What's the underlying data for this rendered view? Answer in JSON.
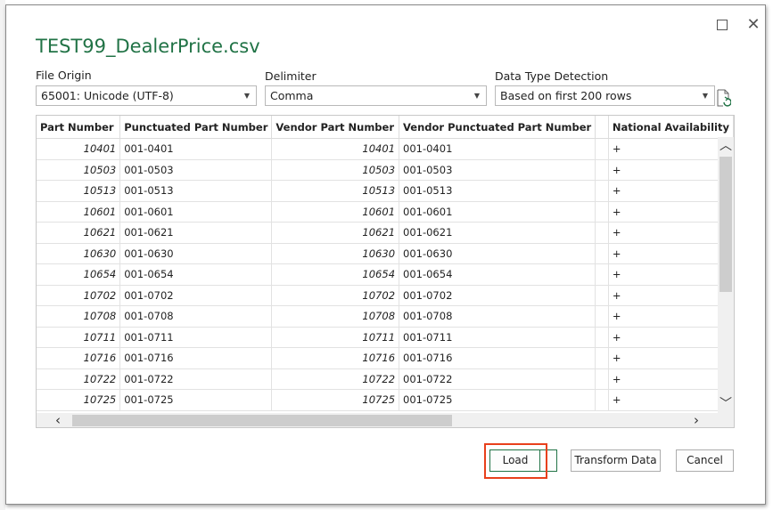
{
  "window": {
    "title": "TEST99_DealerPrice.csv",
    "maximize_icon": "maximize-icon",
    "close_glyph": "✕"
  },
  "file_origin": {
    "label": "File Origin",
    "value": "65001: Unicode (UTF-8)"
  },
  "delimiter": {
    "label": "Delimiter",
    "value": "Comma"
  },
  "detection": {
    "label": "Data Type Detection",
    "value": "Based on first 200 rows"
  },
  "table": {
    "columns": [
      "Part Number",
      "Punctuated Part Number",
      "Vendor Part Number",
      "Vendor Punctuated Part Number",
      "",
      "National Availability"
    ],
    "rows": [
      [
        "10401",
        "001-0401",
        "10401",
        "001-0401",
        "",
        "+"
      ],
      [
        "10503",
        "001-0503",
        "10503",
        "001-0503",
        "",
        "+"
      ],
      [
        "10513",
        "001-0513",
        "10513",
        "001-0513",
        "",
        "+"
      ],
      [
        "10601",
        "001-0601",
        "10601",
        "001-0601",
        "",
        "+"
      ],
      [
        "10621",
        "001-0621",
        "10621",
        "001-0621",
        "",
        "+"
      ],
      [
        "10630",
        "001-0630",
        "10630",
        "001-0630",
        "",
        "+"
      ],
      [
        "10654",
        "001-0654",
        "10654",
        "001-0654",
        "",
        "+"
      ],
      [
        "10702",
        "001-0702",
        "10702",
        "001-0702",
        "",
        "+"
      ],
      [
        "10708",
        "001-0708",
        "10708",
        "001-0708",
        "",
        "+"
      ],
      [
        "10711",
        "001-0711",
        "10711",
        "001-0711",
        "",
        "+"
      ],
      [
        "10716",
        "001-0716",
        "10716",
        "001-0716",
        "",
        "+"
      ],
      [
        "10722",
        "001-0722",
        "10722",
        "001-0722",
        "",
        "+"
      ],
      [
        "10725",
        "001-0725",
        "10725",
        "001-0725",
        "",
        "+"
      ]
    ]
  },
  "buttons": {
    "load": "Load",
    "transform": "Transform Data",
    "cancel": "Cancel"
  },
  "colors": {
    "accent": "#217346",
    "highlight": "#e8401c"
  }
}
